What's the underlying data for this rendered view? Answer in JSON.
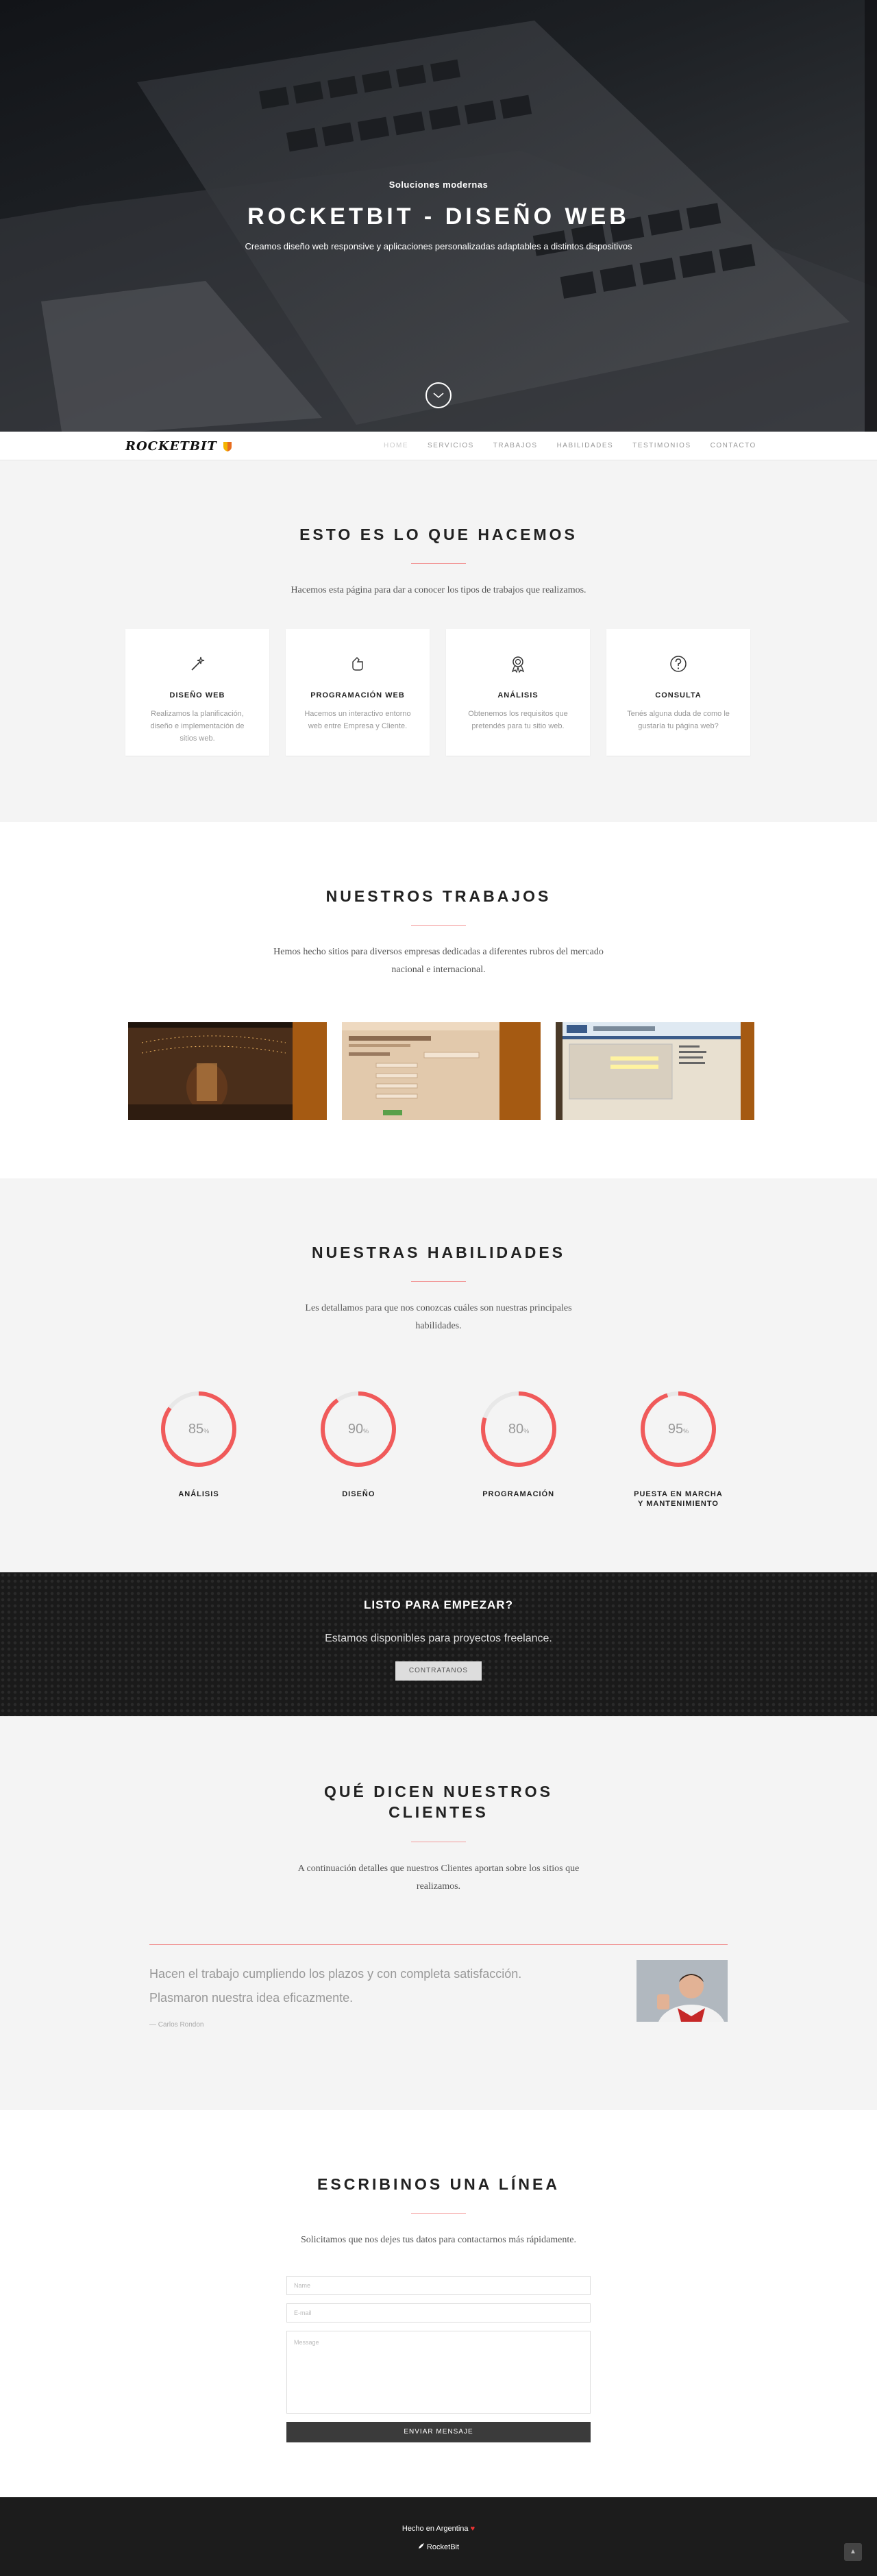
{
  "hero": {
    "kicker": "Soluciones modernas",
    "title": "ROCKETBIT - DISEÑO WEB",
    "subtitle": "Creamos diseño web responsive y aplicaciones personalizadas adaptables a distintos dispositivos"
  },
  "nav": {
    "logo": "ROCKETBIT",
    "items": [
      "HOME",
      "SERVICIOS",
      "TRABAJOS",
      "HABILIDADES",
      "TESTIMONIOS",
      "CONTACTO"
    ]
  },
  "services": {
    "title": "ESTO ES LO QUE HACEMOS",
    "lead": "Hacemos esta página para dar a conocer los tipos de trabajos que realizamos.",
    "cards": [
      {
        "title": "DISEÑO WEB",
        "text": "Realizamos la planificación, diseño e implementación de sitios web."
      },
      {
        "title": "PROGRAMACIÓN WEB",
        "text": "Hacemos un interactivo entorno web entre Empresa y Cliente."
      },
      {
        "title": "ANÁLISIS",
        "text": "Obtenemos los requisitos que pretendés para tu sitio web."
      },
      {
        "title": "CONSULTA",
        "text": "Tenés alguna duda de como le gustaría tu página web?"
      }
    ]
  },
  "works": {
    "title": "NUESTROS TRABAJOS",
    "lead": "Hemos hecho sitios para diversos empresas dedicadas a diferentes rubros del mercado nacional e internacional."
  },
  "skills": {
    "title": "NUESTRAS HABILIDADES",
    "lead": "Les detallamos para que nos conozcas cuáles son nuestras principales habilidades.",
    "items": [
      {
        "label": "ANÁLISIS",
        "value": 85
      },
      {
        "label": "DISEÑO",
        "value": 90
      },
      {
        "label": "PROGRAMACIÓN",
        "value": 80
      },
      {
        "label": "PUESTA EN MARCHA Y MANTENIMIENTO",
        "value": 95
      }
    ],
    "unit": "%",
    "ring_color": "#f05a5a"
  },
  "cta": {
    "title": "LISTO PARA EMPEZAR?",
    "text": "Estamos disponibles para proyectos freelance.",
    "button": "CONTRATANOS"
  },
  "testimonials": {
    "title_line1": "QUÉ DICEN NUESTROS",
    "title_line2": "CLIENTES",
    "lead": "A continuación detalles que nuestros Clientes aportan sobre los sitios que realizamos.",
    "quote": "Hacen el trabajo cumpliendo los plazos y con completa satisfacción. Plasmaron nuestra idea eficazmente.",
    "author": "— Carlos Rondon"
  },
  "contact": {
    "title": "ESCRIBINOS UNA LÍNEA",
    "lead": "Solicitamos que nos dejes tus datos para contactarnos más rápidamente.",
    "name_placeholder": "Name",
    "email_placeholder": "E-mail",
    "message_placeholder": "Message",
    "submit": "ENVIAR MENSAJE"
  },
  "footer": {
    "made": "Hecho en Argentina",
    "heart": "♥",
    "brand": "RocketBit",
    "to_top": "▲"
  }
}
